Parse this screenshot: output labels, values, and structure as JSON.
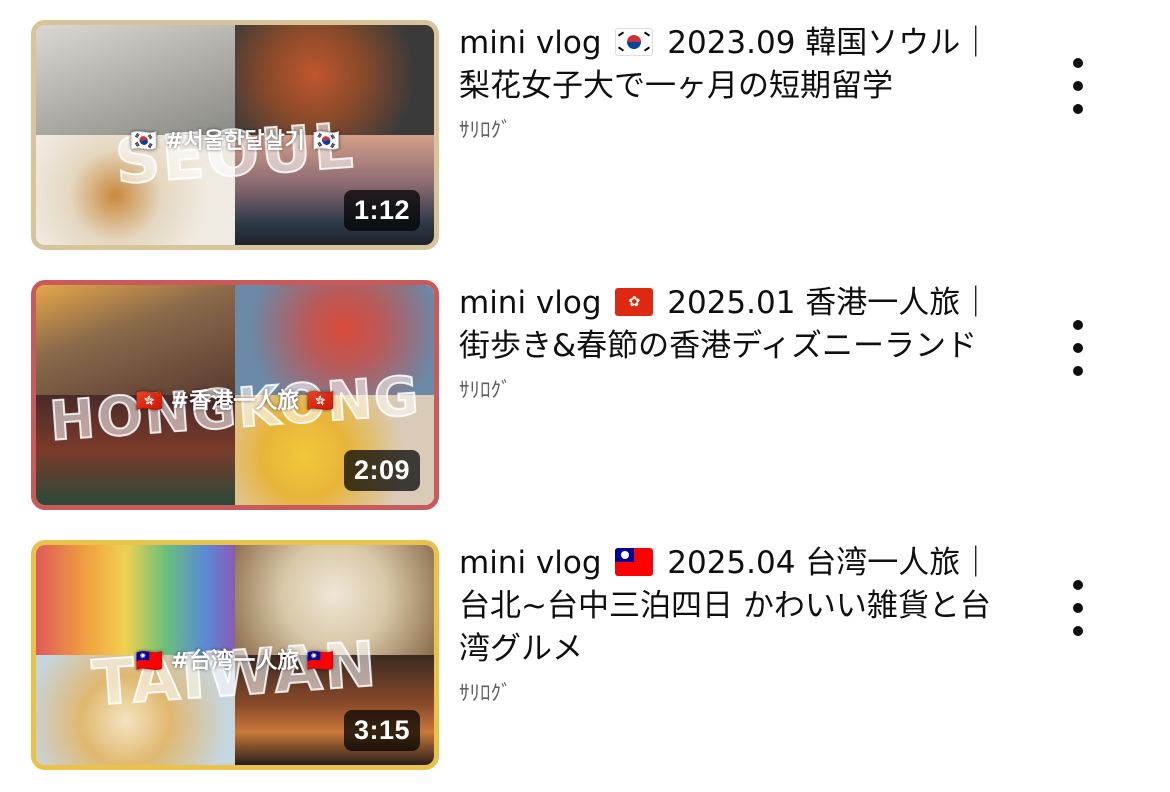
{
  "videos": [
    {
      "title_prefix": "mini vlog",
      "flag": "kr-flag",
      "title_rest": "2023.09 韓国ソウル｜梨花女子大で一ヶ月の短期留学",
      "channel": "ｻﾘﾛｸﾞ",
      "duration": "1:12",
      "thumbnail": {
        "border_color": "#d8c39a",
        "overlay_text": "SEOUL",
        "tag": "🇰🇷 #서울한달살기 🇰🇷",
        "colors": [
          "#b9b7b0",
          "#7c5a3a",
          "#e7dccb",
          "#3a4a5a"
        ]
      }
    },
    {
      "title_prefix": "mini vlog",
      "flag": "hk-flag",
      "title_rest": "2025.01 香港一人旅｜街歩き&春節の香港ディズニーランド",
      "channel": "ｻﾘﾛｸﾞ",
      "duration": "2:09",
      "thumbnail": {
        "border_color": "#c95a5a",
        "overlay_text": "HONGKONG",
        "tag": "🇭🇰 #香港一人旅 🇭🇰",
        "colors": [
          "#7a5a3c",
          "#c84a4a",
          "#5a3a30",
          "#d9b86a"
        ]
      }
    },
    {
      "title_prefix": "mini vlog",
      "flag": "tw-flag",
      "title_rest": "2025.04 台湾一人旅｜台北~台中三泊四日 かわいい雑貨と台湾グルメ",
      "channel": "ｻﾘﾛｸﾞ",
      "duration": "3:15",
      "thumbnail": {
        "border_color": "#e9c24a",
        "overlay_text": "TAIWAN",
        "tag": "🇹🇼 #台湾一人旅 🇹🇼",
        "colors": [
          "#d96a6a",
          "#d8c8a8",
          "#e8d2a0",
          "#5a3a28"
        ]
      }
    }
  ]
}
